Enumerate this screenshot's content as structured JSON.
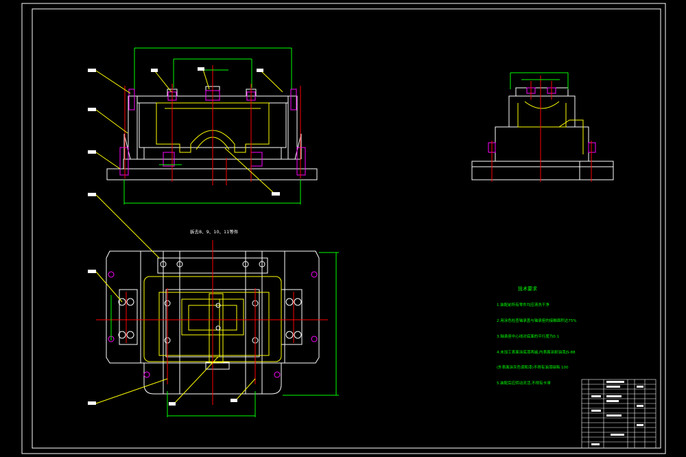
{
  "drawing": {
    "background": "#000000",
    "colors": {
      "frame": "#ffffff",
      "outline": "#ffffff",
      "dimension": "#00ff00",
      "leader": "#ffff00",
      "centerline": "#ff0000",
      "bolt": "#ff00ff",
      "casting": "#ffff00",
      "notes": "#00ff00"
    },
    "view_label": "拆去8、9、10、11等件",
    "tech_notes": {
      "title": "技术要求",
      "lines": [
        "1.装配前所有零件均应清洗干净",
        "2.用涂色检查轴承盖与轴承座的接触面积达75%",
        "3.轴承座中心线对底面的平行度为0.1",
        "4.未加工表面涂底漆两遍,内表面涂耐油漆JS-88",
        "(外表面涂灰色调和漆)不得有油漆缺陷 100",
        "5.装配后应转动灵活,不得有卡滞"
      ]
    },
    "part_balloons": [
      "8",
      "9",
      "10",
      "11",
      "7",
      "6",
      "12",
      "5",
      "4",
      "3",
      "2",
      "1"
    ]
  }
}
